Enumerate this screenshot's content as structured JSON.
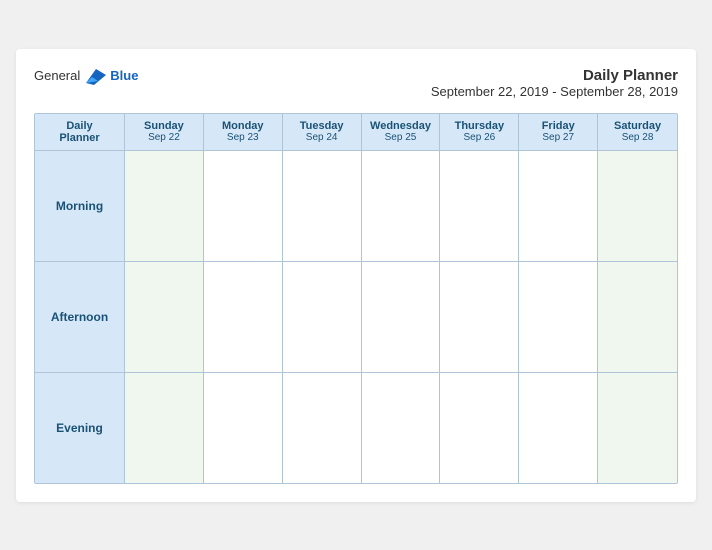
{
  "header": {
    "logo": {
      "general": "General",
      "blue": "Blue",
      "bird_shape": "▶"
    },
    "title": "Daily Planner",
    "subtitle": "September 22, 2019 - September 28, 2019"
  },
  "columns": [
    {
      "id": "daily-planner",
      "label": "Daily",
      "label2": "Planner",
      "date": ""
    },
    {
      "id": "sunday",
      "label": "Sunday",
      "date": "Sep 22"
    },
    {
      "id": "monday",
      "label": "Monday",
      "date": "Sep 23"
    },
    {
      "id": "tuesday",
      "label": "Tuesday",
      "date": "Sep 24"
    },
    {
      "id": "wednesday",
      "label": "Wednesday",
      "date": "Sep 25"
    },
    {
      "id": "thursday",
      "label": "Thursday",
      "date": "Sep 26"
    },
    {
      "id": "friday",
      "label": "Friday",
      "date": "Sep 27"
    },
    {
      "id": "saturday",
      "label": "Saturday",
      "date": "Sep 28"
    }
  ],
  "rows": [
    {
      "id": "morning",
      "label": "Morning"
    },
    {
      "id": "afternoon",
      "label": "Afternoon"
    },
    {
      "id": "evening",
      "label": "Evening"
    }
  ]
}
